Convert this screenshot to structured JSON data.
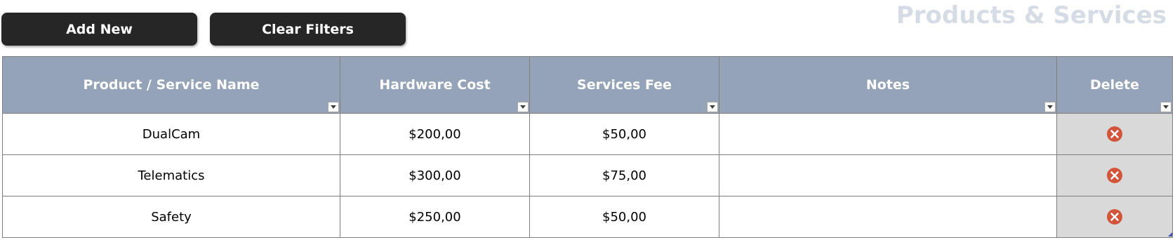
{
  "toolbar": {
    "add_label": "Add New",
    "clear_label": "Clear Filters"
  },
  "page": {
    "title": "Products & Services"
  },
  "table": {
    "columns": [
      "Product / Service Name",
      "Hardware Cost",
      "Services Fee",
      "Notes",
      "Delete"
    ],
    "rows": [
      {
        "name": "DualCam",
        "hardware": "$200,00",
        "services": "$50,00",
        "notes": ""
      },
      {
        "name": "Telematics",
        "hardware": "$300,00",
        "services": "$75,00",
        "notes": ""
      },
      {
        "name": "Safety",
        "hardware": "$250,00",
        "services": "$50,00",
        "notes": ""
      }
    ]
  },
  "icons": {
    "filter": "filter-dropdown-icon",
    "delete": "delete-x-circle-icon"
  },
  "colors": {
    "button_bg": "#262626",
    "header_bg": "#94a3b8",
    "title": "#d6dce5",
    "delete_cell_bg": "#d9d9d9",
    "delete_icon": "#d2553b"
  }
}
